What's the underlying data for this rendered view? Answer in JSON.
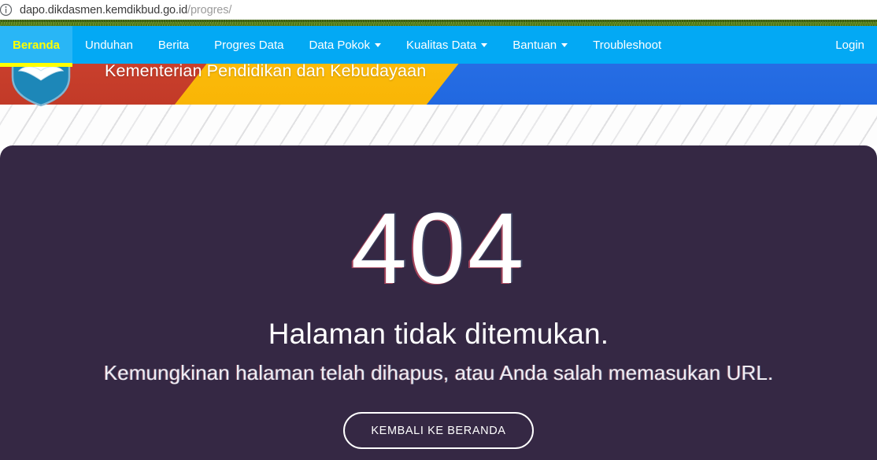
{
  "browser": {
    "info_icon": "info-circle-icon",
    "url_host": "dapo.dikdasmen.kemdikbud.go.id",
    "url_path": "/progres/"
  },
  "banner": {
    "logo": "tut-wuri-handayani-logo",
    "title": "Kementerian Pendidikan dan Kebudayaan",
    "colors": {
      "red": "#cf4430",
      "yellow": "#fdc010",
      "blue": "#2b72e8",
      "green_triangle": "#069a52"
    }
  },
  "nav": {
    "background": "#03a9f4",
    "active_color": "#ffff00",
    "items": [
      {
        "label": "Beranda",
        "active": true,
        "has_caret": false
      },
      {
        "label": "Unduhan",
        "active": false,
        "has_caret": false
      },
      {
        "label": "Berita",
        "active": false,
        "has_caret": false
      },
      {
        "label": "Progres Data",
        "active": false,
        "has_caret": false
      },
      {
        "label": "Data Pokok",
        "active": false,
        "has_caret": true
      },
      {
        "label": "Kualitas Data",
        "active": false,
        "has_caret": true
      },
      {
        "label": "Bantuan",
        "active": false,
        "has_caret": true
      },
      {
        "label": "Troubleshoot",
        "active": false,
        "has_caret": false
      }
    ],
    "right_item": {
      "label": "Login"
    }
  },
  "error_page": {
    "background": "#352844",
    "code": "404",
    "headline": "Halaman tidak ditemukan.",
    "subline": "Kemungkinan halaman telah dihapus, atau Anda salah memasukan URL.",
    "button_label": "KEMBALI KE BERANDA"
  }
}
